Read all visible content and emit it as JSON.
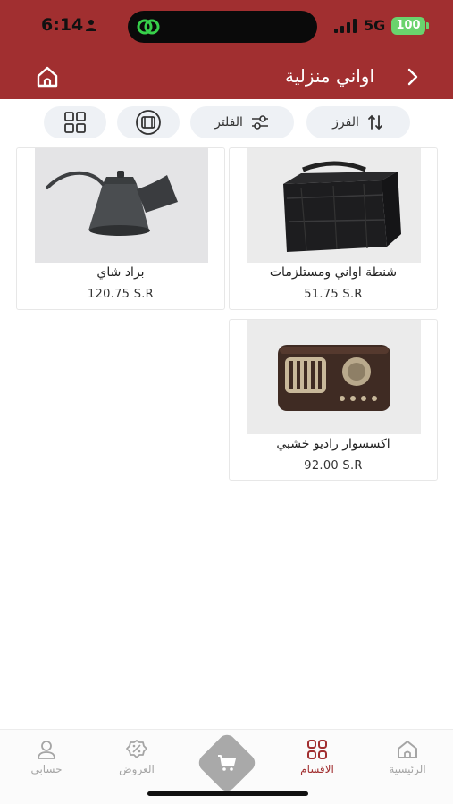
{
  "status_bar": {
    "time": "6:14",
    "network": "5G",
    "battery": "100"
  },
  "header": {
    "title": "اواني منزلية",
    "home_icon": "home-icon",
    "back_icon": "chevron-right-icon"
  },
  "toolbar": {
    "sort_label": "الفرز",
    "filter_label": "الفلتر",
    "view_list_icon": "film-view-icon",
    "view_grid_icon": "grid-view-icon"
  },
  "products": [
    {
      "name": "شنطة اواني ومستلزمات",
      "price": "51.75  S.R",
      "image": "insulated-bag-image"
    },
    {
      "name": "براد شاي",
      "price": "120.75  S.R",
      "image": "kettle-image"
    },
    {
      "name": "اكسسوار راديو خشبي",
      "price": "92.00  S.R",
      "image": "radio-image"
    }
  ],
  "bottom_nav": {
    "items": [
      {
        "label": "الرئيسية",
        "icon": "home-icon",
        "active": false
      },
      {
        "label": "الاقسام",
        "icon": "categories-icon",
        "active": true
      },
      {
        "label": "العروض",
        "icon": "offers-icon",
        "active": false
      },
      {
        "label": "حسابي",
        "icon": "user-icon",
        "active": false
      }
    ],
    "cart_icon": "cart-icon"
  },
  "colors": {
    "brand": "#a12f30",
    "pill_bg": "#eef1f5",
    "nav_inactive": "#a5a5a5"
  }
}
